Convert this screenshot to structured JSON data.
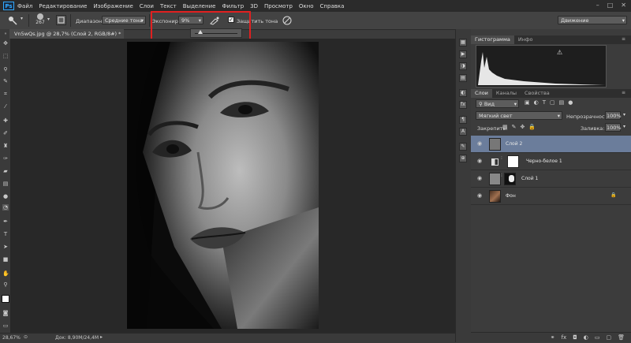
{
  "app": {
    "logo": "Ps"
  },
  "menu": [
    "Файл",
    "Редактирование",
    "Изображение",
    "Слои",
    "Текст",
    "Выделение",
    "Фильтр",
    "3D",
    "Просмотр",
    "Окно",
    "Справка"
  ],
  "window_controls": [
    "–",
    "□",
    "✕"
  ],
  "options": {
    "brush_size": "267",
    "range_label": "Диапазон:",
    "range_value": "Средние тона",
    "exposure_label": "Экспонир.:",
    "exposure_value": "9%",
    "protect_label": "Защитить тона",
    "protect_checked": true,
    "workspace": "Движение"
  },
  "document": {
    "tab_title": "Vn5wQs.jpg @ 28,7% (Слой 2, RGB/8#) *",
    "zoom": "28,67%",
    "doc_size": "Док: 8,90M/24,4M"
  },
  "histogram_panel": {
    "tabs": [
      "Гистограмма",
      "Инфо"
    ],
    "warning": "⚠"
  },
  "layers_panel": {
    "tabs": [
      "Слои",
      "Каналы",
      "Свойства"
    ],
    "filter_kind": "Вид",
    "blend_mode": "Мягкий свет",
    "opacity_label": "Непрозрачность:",
    "opacity_value": "100%",
    "lock_label": "Закрепить:",
    "fill_label": "Заливка:",
    "fill_value": "100%",
    "layers": [
      {
        "name": "Слой 2",
        "selected": true
      },
      {
        "name": "Черно-белое 1",
        "selected": false
      },
      {
        "name": "Слой 1",
        "selected": false
      },
      {
        "name": "Фон",
        "selected": false,
        "locked": true
      }
    ],
    "footer_icons": [
      "link-icon",
      "fx-icon",
      "mask-icon",
      "adjustment-icon",
      "group-icon",
      "new-layer-icon",
      "trash-icon"
    ]
  },
  "icons": {
    "eye": "◉",
    "lock": "🔒"
  }
}
